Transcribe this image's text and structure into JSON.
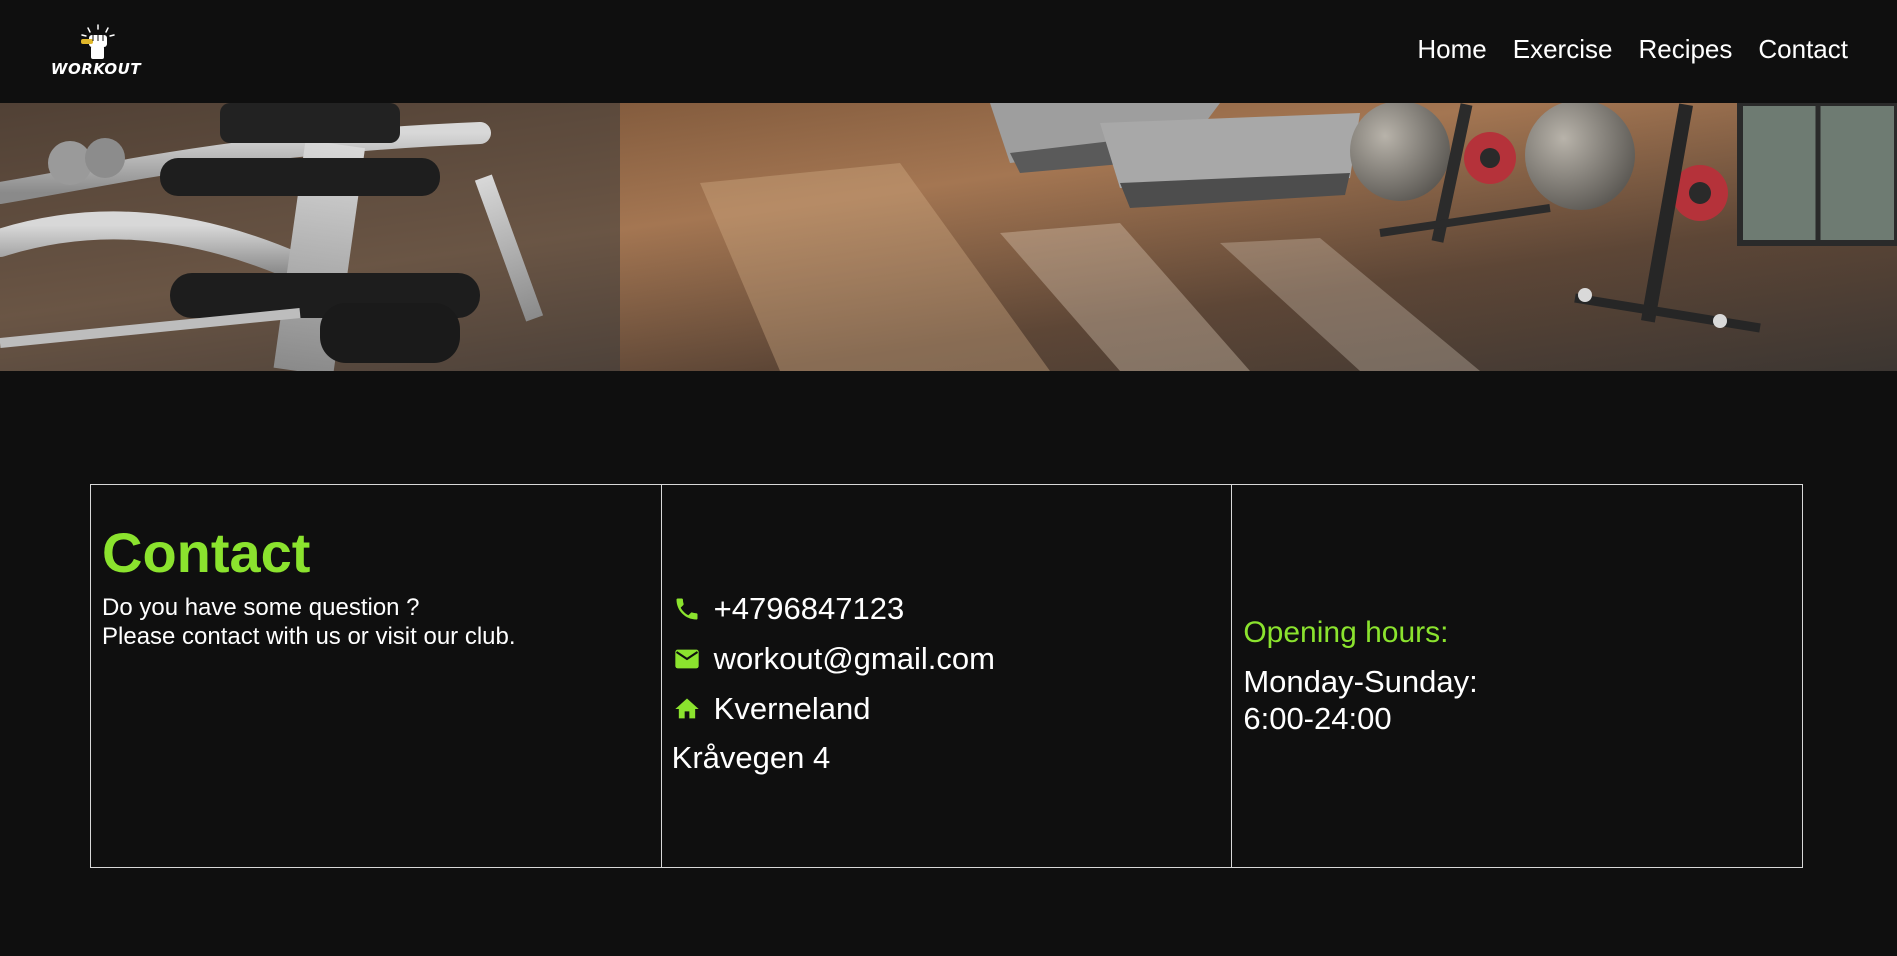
{
  "brand": {
    "logo_text": "WORKOUT",
    "logo_icon": "raised-fist-icon",
    "accent_color": "#8be32e",
    "background_color": "#0f0f0f"
  },
  "nav": {
    "items": [
      {
        "label": "Home"
      },
      {
        "label": "Exercise"
      },
      {
        "label": "Recipes"
      },
      {
        "label": "Contact"
      }
    ]
  },
  "hero": {
    "image": "gym-interior-photo"
  },
  "contact": {
    "title": "Contact",
    "question": "Do you have some question ?",
    "invite": "Please contact with us or visit our club."
  },
  "info": {
    "phone": {
      "icon": "phone-icon",
      "value": "+4796847123"
    },
    "email": {
      "icon": "mail-icon",
      "value": "workout@gmail.com"
    },
    "address": {
      "icon": "home-icon",
      "line1": "Kverneland",
      "line2": "Kråvegen 4"
    }
  },
  "hours": {
    "title": "Opening hours:",
    "days": "Monday-Sunday:",
    "time": "6:00-24:00"
  }
}
